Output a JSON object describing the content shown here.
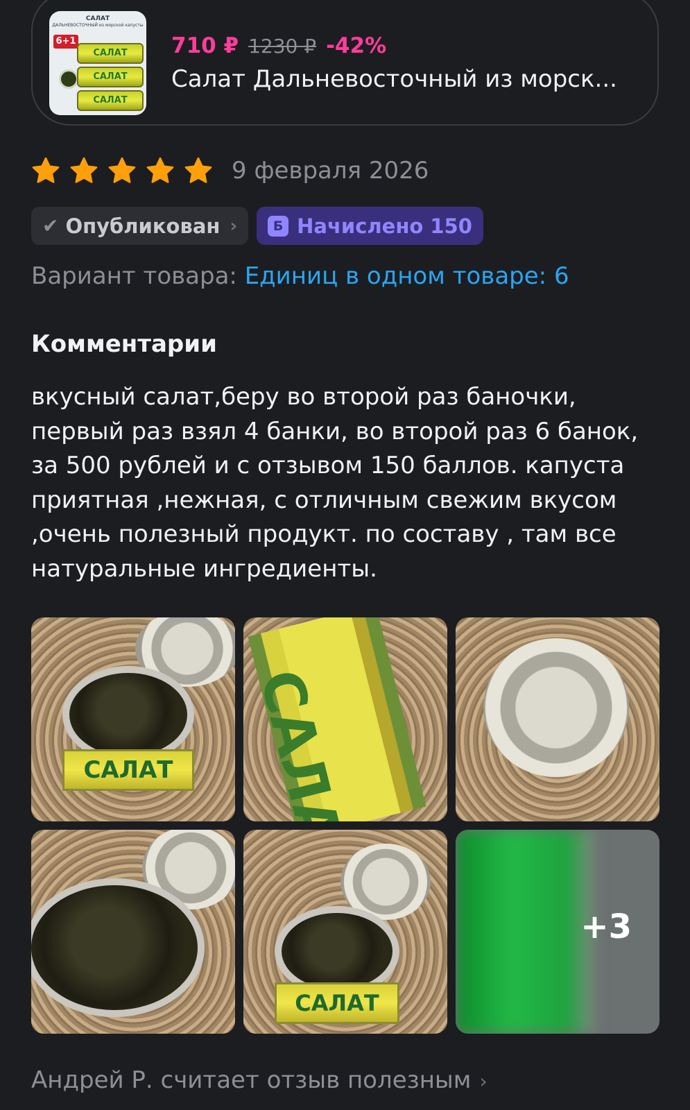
{
  "product": {
    "price_current": "710 ₽",
    "price_old": "1230 ₽",
    "discount": "-42%",
    "title": "Салат Дальневосточный из морск...",
    "thumb_heading": "САЛАТ",
    "thumb_subheading": "ДАЛЬНЕВОСТОЧНЫЙ из морской капусты",
    "thumb_badge": "6+1",
    "thumb_can_label": "САЛАТ"
  },
  "review": {
    "rating": 5,
    "rating_max": 5,
    "date": "9 февраля 2026",
    "status_badge": "Опубликован",
    "bonus_icon_letter": "Б",
    "bonus_label": "Начислено 150",
    "variant_label": "Вариант товара:",
    "variant_value": "Единиц в одном товаре: 6",
    "comments_title": "Комментарии",
    "comment_text": "вкусный салат,беру во второй раз баночки, первый раз взял 4 банки, во второй раз 6 банок, за 500 рублей и с отзывом 150 баллов. капуста приятная ,нежная, с отличным свежим вкусом ,очень полезный продукт. по составу , там все натуральные ингредиенты.",
    "photos": {
      "can_label": "САЛАТ",
      "more_count": "+3"
    },
    "helpful_text": "Андрей Р. считает отзыв полезным"
  },
  "colors": {
    "background": "#1c1d21",
    "price_accent": "#ff3d9a",
    "star": "#ff9f0a",
    "link": "#2aa6f2",
    "bonus_bg": "#3a2f7d",
    "bonus_fg": "#8f86ff"
  }
}
